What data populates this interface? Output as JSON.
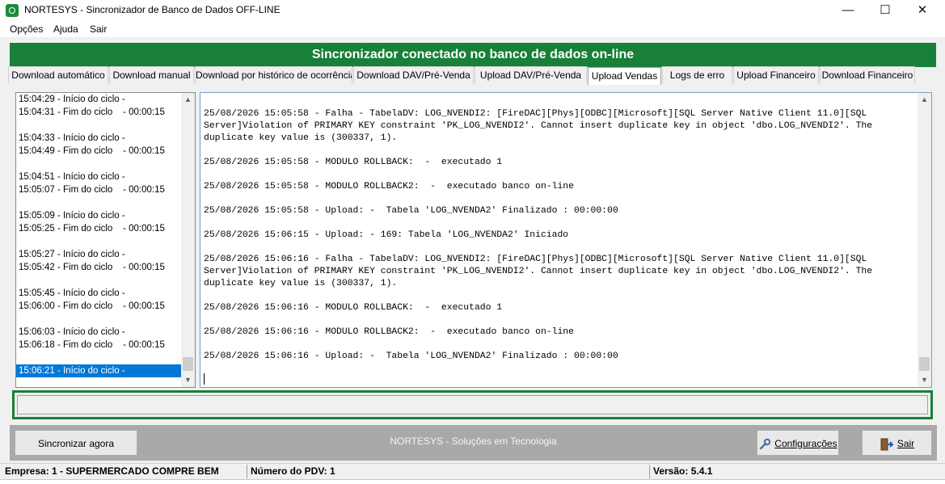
{
  "window": {
    "title": "NORTESYS - Sincronizador de Banco de Dados OFF-LINE",
    "minimize": "—",
    "maximize": "☐",
    "close": "✕"
  },
  "menu": [
    "Opções",
    "Ajuda",
    "Sair"
  ],
  "banner": "Sincronizador conectado no banco de dados on-line",
  "tabs": [
    "Download automático",
    "Download manual",
    "Download por histórico de ocorrência",
    "Download DAV/Pré-Venda",
    "Upload DAV/Pré-Venda",
    "Upload Vendas",
    "Logs de erro",
    "Upload Financeiro",
    "Download Financeiro"
  ],
  "active_tab": "Upload Vendas",
  "cycles": [
    {
      "start": "15:04:29 - Início do ciclo -",
      "end": "15:04:31 - Fim do ciclo    - 00:00:15"
    },
    {
      "start": "15:04:33 - Início do ciclo -",
      "end": "15:04:49 - Fim do ciclo    - 00:00:15"
    },
    {
      "start": "15:04:51 - Início do ciclo -",
      "end": "15:05:07 - Fim do ciclo    - 00:00:15"
    },
    {
      "start": "15:05:09 - Início do ciclo -",
      "end": "15:05:25 - Fim do ciclo    - 00:00:15"
    },
    {
      "start": "15:05:27 - Início do ciclo -",
      "end": "15:05:42 - Fim do ciclo    - 00:00:15"
    },
    {
      "start": "15:05:45 - Início do ciclo -",
      "end": "15:06:00 - Fim do ciclo    - 00:00:15"
    },
    {
      "start": "15:06:03 - Início do ciclo -",
      "end": "15:06:18 - Fim do ciclo    - 00:00:15"
    },
    {
      "start": "15:06:21 - Início do ciclo -",
      "end": ""
    }
  ],
  "log": [
    "25/08/2026 15:05:58 - Falha - TabelaDV: LOG_NVENDI2: [FireDAC][Phys][ODBC][Microsoft][SQL Server Native Client 11.0][SQL Server]Violation of PRIMARY KEY constraint 'PK_LOG_NVENDI2'. Cannot insert duplicate key in object 'dbo.LOG_NVENDI2'. The duplicate key value is (300337, 1).",
    "25/08/2026 15:05:58 - MODULO ROLLBACK:  -  executado 1",
    "25/08/2026 15:05:58 - MODULO ROLLBACK2:  -  executado banco on-line",
    "25/08/2026 15:05:58 - Upload: -  Tabela 'LOG_NVENDA2' Finalizado : 00:00:00",
    "25/08/2026 15:06:15 - Upload: - 169: Tabela 'LOG_NVENDA2' Iniciado",
    "25/08/2026 15:06:16 - Falha - TabelaDV: LOG_NVENDI2: [FireDAC][Phys][ODBC][Microsoft][SQL Server Native Client 11.0][SQL Server]Violation of PRIMARY KEY constraint 'PK_LOG_NVENDI2'. Cannot insert duplicate key in object 'dbo.LOG_NVENDI2'. The duplicate key value is (300337, 1).",
    "25/08/2026 15:06:16 - MODULO ROLLBACK:  -  executado 1",
    "25/08/2026 15:06:16 - MODULO ROLLBACK2:  -  executado banco on-line",
    "25/08/2026 15:06:16 - Upload: -  Tabela 'LOG_NVENDA2' Finalizado : 00:00:00"
  ],
  "buttons": {
    "sync": "Sincronizar agora",
    "config": "Configurações",
    "exit": "Sair"
  },
  "footer_center": "NORTESYS - Soluções em Tecnologia",
  "status": {
    "empresa": "Empresa: 1 - SUPERMERCADO COMPRE BEM",
    "pdv": "Número do PDV: 1",
    "versao": "Versão: 5.4.1"
  },
  "colors": {
    "accent_green": "#188038",
    "selection_blue": "#0078d7"
  },
  "icons": [
    "app-icon",
    "gear-icon",
    "exit-door-icon",
    "scroll-up-icon",
    "scroll-down-icon"
  ]
}
